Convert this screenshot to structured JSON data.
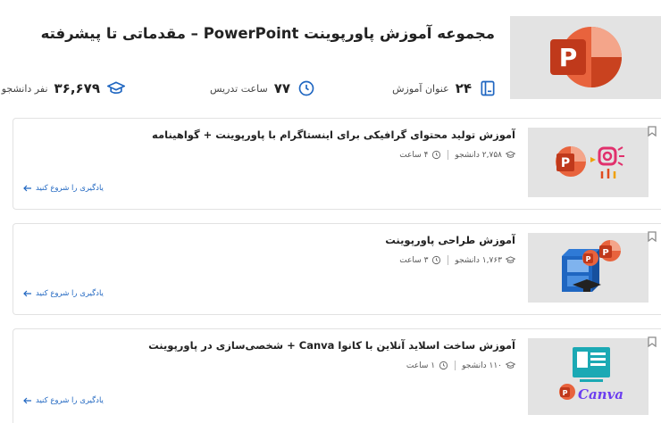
{
  "header": {
    "title": "مجموعه آموزش پاورپوینت PowerPoint – مقدماتی تا پیشرفته",
    "stats": {
      "courses": {
        "value": "۲۴",
        "label": "عنوان آموزش"
      },
      "hours": {
        "value": "۷۷",
        "label": "ساعت تدریس"
      },
      "students": {
        "value": "۳۶,۶۷۹",
        "label": "نفر دانشجو"
      }
    }
  },
  "cards": [
    {
      "title": "آموزش تولید محتوای گرافیکی برای اینستاگرام با پاورپوینت + گواهینامه",
      "students": "۲,۷۵۸ دانشجو",
      "hours": "۴ ساعت",
      "cta": "یادگیری را شروع کنید"
    },
    {
      "title": "آموزش طراحی پاورپوینت",
      "students": "۱,۷۶۳ دانشجو",
      "hours": "۳ ساعت",
      "cta": "یادگیری را شروع کنید"
    },
    {
      "title": "آموزش ساخت اسلاید آنلاین با کانوا Canva + شخصی‌سازی در پاورپوینت",
      "students": "۱۱۰ دانشجو",
      "hours": "۱ ساعت",
      "cta": "یادگیری را شروع کنید",
      "thumb_text": "Canva"
    }
  ],
  "colors": {
    "accent": "#1f66c1",
    "powerpoint": "#d04423",
    "instagram": "#e1306c",
    "canva_teal": "#1ba9b4",
    "canva_purple": "#6b3df0"
  },
  "icons": {
    "bookmark": "bookmark-icon",
    "book": "book-icon",
    "clock": "clock-icon",
    "graduation": "graduation-cap-icon",
    "arrow": "arrow-left-icon"
  }
}
